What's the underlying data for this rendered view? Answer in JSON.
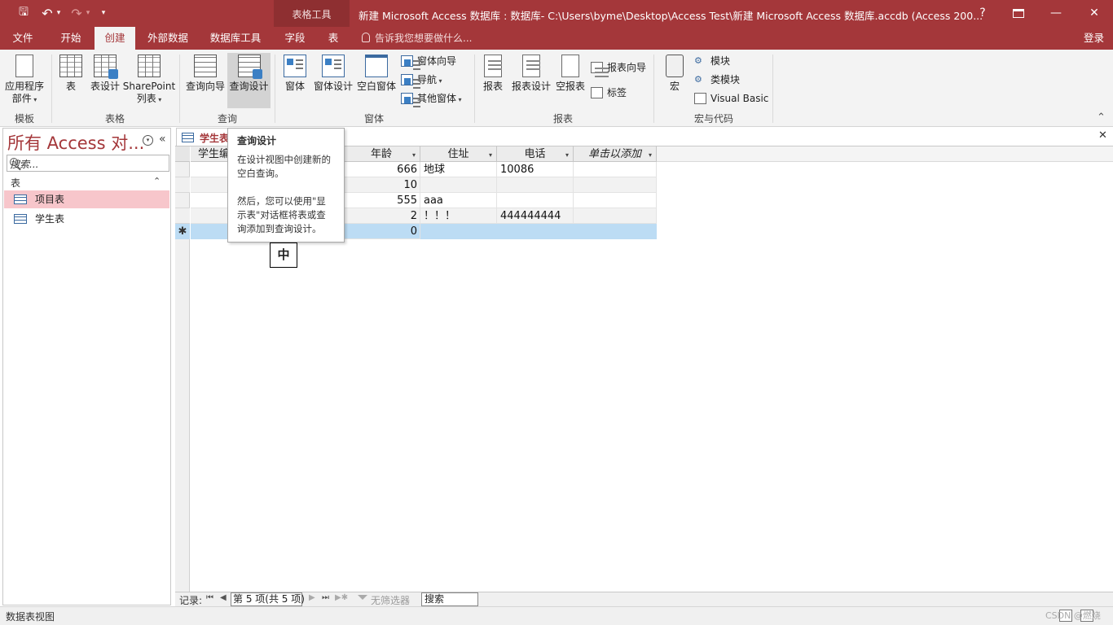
{
  "window": {
    "title": "新建 Microsoft Access 数据库 : 数据库- C:\\Users\\byme\\Desktop\\Access Test\\新建 Microsoft Access 数据库.accdb (Access 200...",
    "context_tools": "表格工具",
    "help": "?",
    "minimize": "—",
    "restore": "❐",
    "close": "✕"
  },
  "quick_access": {
    "save": "🖫",
    "undo": "↶",
    "undo_caret": "▾",
    "redo": "↷",
    "redo_caret": "▾",
    "customize": "▾"
  },
  "tabs": [
    {
      "label": "文件"
    },
    {
      "label": "开始"
    },
    {
      "label": "创建",
      "active": true
    },
    {
      "label": "外部数据"
    },
    {
      "label": "数据库工具"
    },
    {
      "label": "字段"
    },
    {
      "label": "表"
    }
  ],
  "tell_me": "告诉我您想要做什么...",
  "sign_in": "登录",
  "ribbon": {
    "groups": {
      "templates": "模板",
      "tables": "表格",
      "queries": "查询",
      "forms": "窗体",
      "reports": "报表",
      "macros": "宏与代码"
    },
    "buttons": {
      "app_parts_1": "应用程序",
      "app_parts_2": "部件",
      "table": "表",
      "table_design": "表设计",
      "sharepoint_1": "SharePoint",
      "sharepoint_2": "列表",
      "query_wizard": "查询向导",
      "query_design": "查询设计",
      "form": "窗体",
      "form_design": "窗体设计",
      "blank_form": "空白窗体",
      "form_wizard": "窗体向导",
      "navigation": "导航",
      "more_forms": "其他窗体",
      "report": "报表",
      "report_design": "报表设计",
      "blank_report": "空报表",
      "report_wizard": "报表向导",
      "labels": "标签",
      "macro": "宏",
      "module": "模块",
      "class_module": "类模块",
      "visual_basic": "Visual Basic"
    },
    "collapse": "⌃"
  },
  "nav_pane": {
    "title": "所有 Access 对...",
    "menu": "▾",
    "collapse": "«",
    "search_placeholder": "搜索...",
    "group": "表",
    "group_toggle": "⌃",
    "items": [
      {
        "label": "项目表",
        "selected": true
      },
      {
        "label": "学生表",
        "selected": false
      }
    ]
  },
  "document": {
    "tab_label": "学生表",
    "close": "✕",
    "columns": [
      "学生编号",
      "",
      "年龄",
      "住址",
      "电话",
      "单击以添加"
    ],
    "rows": [
      {
        "age": "666",
        "address": "地球",
        "phone": "10086"
      },
      {
        "age": "10",
        "address": "",
        "phone": ""
      },
      {
        "age": "555",
        "address": "aaa",
        "phone": ""
      },
      {
        "age": "2",
        "address": "！！！",
        "phone": "444444444"
      }
    ],
    "new_row": {
      "marker": "✱",
      "age": "0"
    }
  },
  "tooltip": {
    "title": "查询设计",
    "lines": [
      "在设计视图中创建新的",
      "空白查询。",
      "",
      "然后，您可以使用\"显",
      "示表\"对话框将表或查",
      "询添加到查询设计。"
    ]
  },
  "ime": "中",
  "record_nav": {
    "label": "记录:",
    "first": "⏮",
    "prev": "◀",
    "current": "第 5 项(共 5 项)",
    "next": "▶",
    "last": "⏭",
    "new": "▶✱",
    "no_filter": "无筛选器",
    "search": "搜索"
  },
  "status_bar": {
    "text": "数据表视图",
    "watermark": "CSDN @燃烧"
  },
  "colors": {
    "accent": "#a4373a",
    "selected_nav": "#f7c6cb",
    "new_row": "#bcdcf4"
  }
}
